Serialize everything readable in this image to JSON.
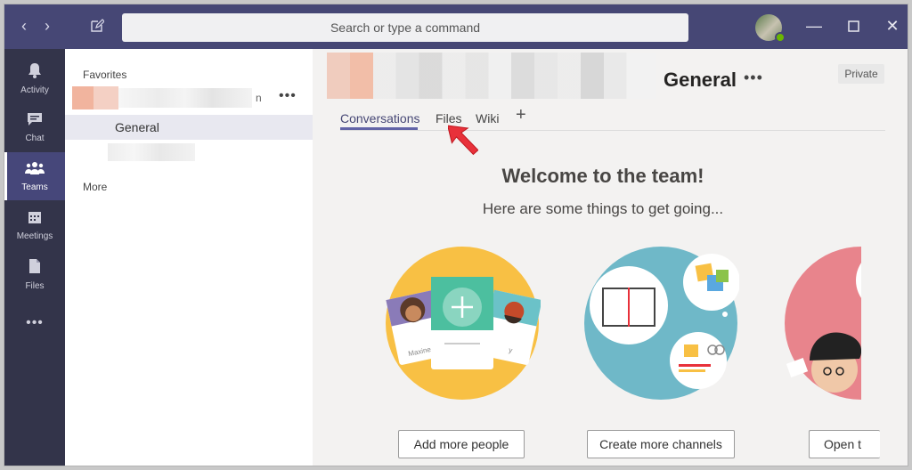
{
  "titlebar": {
    "search_placeholder": "Search or type a command"
  },
  "rail": {
    "items": [
      {
        "label": "Activity",
        "icon": "bell-icon"
      },
      {
        "label": "Chat",
        "icon": "chat-icon"
      },
      {
        "label": "Teams",
        "icon": "teams-icon"
      },
      {
        "label": "Meetings",
        "icon": "calendar-icon"
      },
      {
        "label": "Files",
        "icon": "file-icon"
      }
    ],
    "more": "•••"
  },
  "panel": {
    "favorites_label": "Favorites",
    "team_name_suffix": "n",
    "team_more": "•••",
    "channel_general": "General",
    "more_label": "More"
  },
  "main": {
    "channel_title": "General",
    "channel_more": "•••",
    "private_badge": "Private",
    "tabs": [
      {
        "label": "Conversations",
        "active": true
      },
      {
        "label": "Files",
        "active": false
      },
      {
        "label": "Wiki",
        "active": false
      }
    ],
    "tab_add": "+",
    "welcome_title": "Welcome to the team!",
    "welcome_subtitle": "Here are some things to get going...",
    "illustration_labels": [
      "Maxine",
      "y"
    ],
    "actions": [
      {
        "label": "Add more people"
      },
      {
        "label": "Create more channels"
      },
      {
        "label": "Open t"
      }
    ]
  },
  "colors": {
    "titlebar": "#464775",
    "rail": "#33344a",
    "accent": "#6264a7",
    "annotation_arrow": "#e8313a"
  }
}
